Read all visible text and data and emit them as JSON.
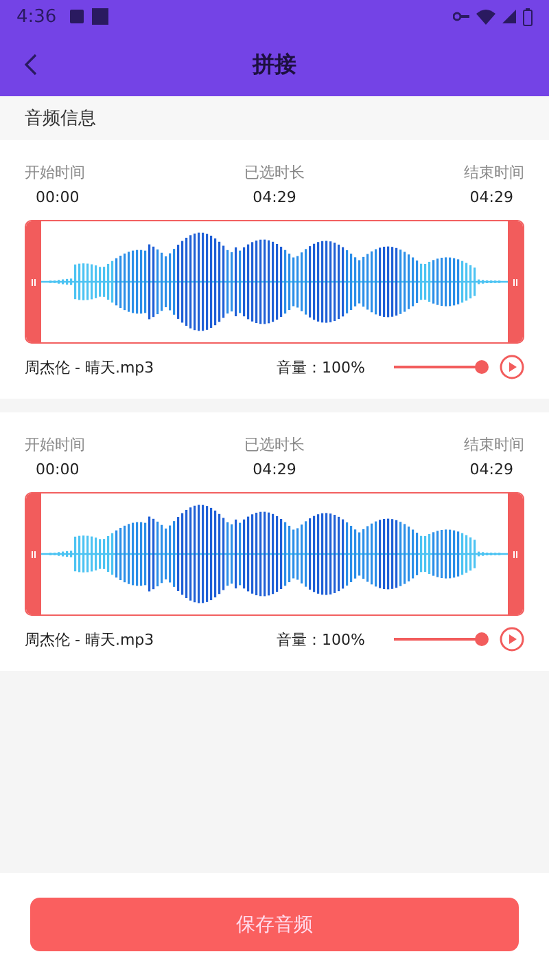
{
  "status_bar": {
    "time": "4:36"
  },
  "toolbar": {
    "title": "拼接"
  },
  "section": {
    "title": "音频信息"
  },
  "tracks": [
    {
      "start_label": "开始时间",
      "start": "00:00",
      "duration_label": "已选时长",
      "duration": "04:29",
      "end_label": "结束时间",
      "end": "04:29",
      "file": "周杰伦 - 晴天.mp3",
      "volume_label": "音量：",
      "volume": "100%",
      "level": 1
    },
    {
      "start_label": "开始时间",
      "start": "00:00",
      "duration_label": "已选时长",
      "duration": "04:29",
      "end_label": "结束时间",
      "end": "04:29",
      "file": "周杰伦 - 晴天.mp3",
      "volume_label": "音量：",
      "volume": "100%",
      "level": 1
    }
  ],
  "save_button": "保存音频"
}
